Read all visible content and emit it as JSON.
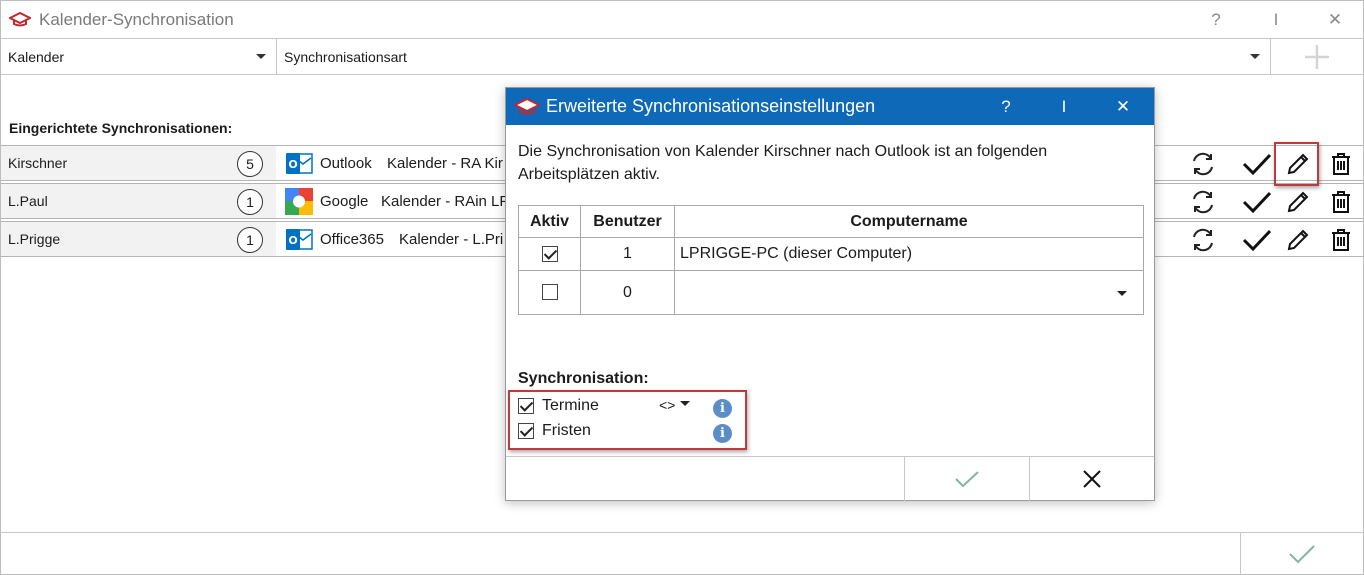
{
  "window": {
    "title": "Kalender-Synchronisation",
    "help_label": "?",
    "pin_label": "I",
    "close_label": "✕"
  },
  "filters": {
    "calendar_value": "Kalender",
    "sync_type_value": "Synchronisationsart"
  },
  "section_title": "Eingerichtete Synchronisationen:",
  "rows": [
    {
      "name": "Kirschner",
      "count": "5",
      "service_icon": "outlook-icon",
      "service": "Outlook",
      "calendar": "Kalender - RA Kir"
    },
    {
      "name": "L.Paul",
      "count": "1",
      "service_icon": "google-icon",
      "service": "Google",
      "calendar": "Kalender - RAin LP"
    },
    {
      "name": "L.Prigge",
      "count": "1",
      "service_icon": "office365-icon",
      "service": "Office365",
      "calendar": "Kalender - L.Pri"
    }
  ],
  "dialog": {
    "title": "Erweiterte Synchronisationseinstellungen",
    "help_label": "?",
    "pin_label": "I",
    "close_label": "✕",
    "message": "Die Synchronisation von Kalender Kirschner nach Outlook ist an folgenden Arbeitsplätzen aktiv.",
    "table": {
      "headers": [
        "Aktiv",
        "Benutzer",
        "Computername"
      ],
      "rows": [
        {
          "active": true,
          "users": "1",
          "computer": "LPRIGGE-PC (dieser Computer)"
        },
        {
          "active": false,
          "users": "0",
          "computer": ""
        }
      ]
    },
    "sync_section_label": "Synchronisation:",
    "sync_items": [
      {
        "label": "Termine",
        "checked": true,
        "direction": "<>"
      },
      {
        "label": "Fristen",
        "checked": true
      }
    ],
    "info_label": "i"
  },
  "colors": {
    "dialog_titlebar": "#0e6ab9",
    "highlight": "#c0393b",
    "ok_check": "#7fb6a7"
  }
}
